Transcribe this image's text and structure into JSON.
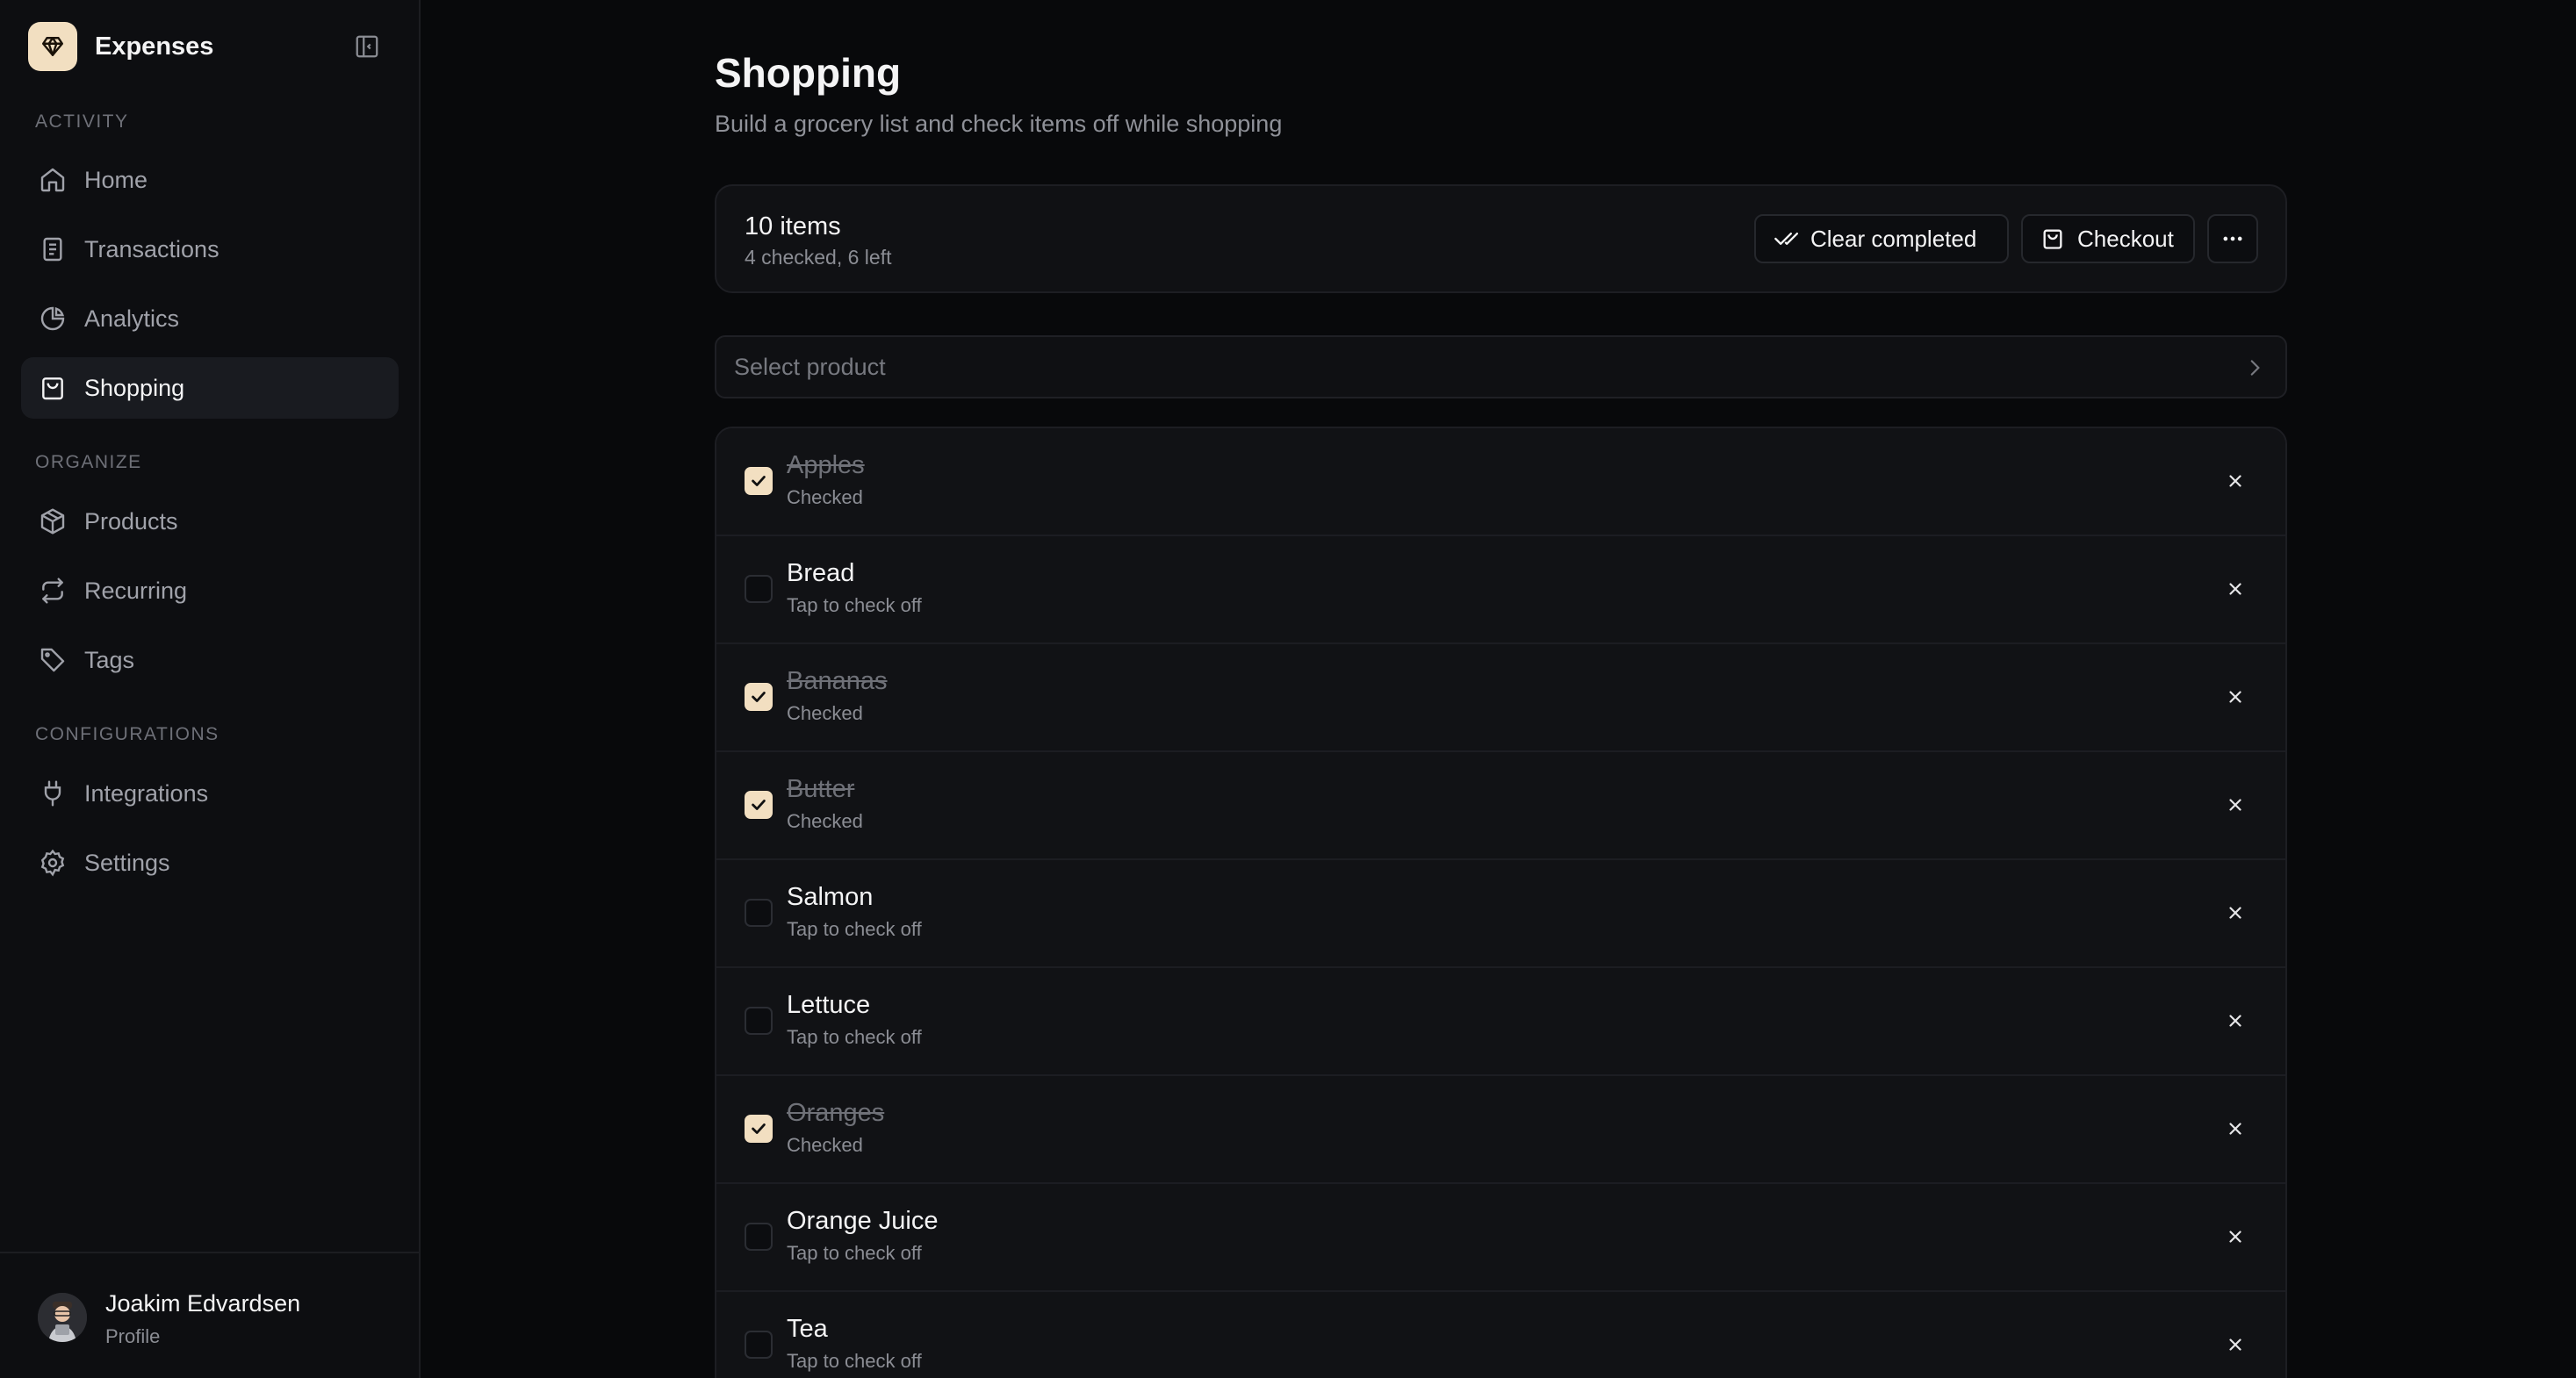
{
  "app": {
    "name": "Expenses"
  },
  "sidebar": {
    "sections": [
      {
        "label": "ACTIVITY"
      },
      {
        "label": "ORGANIZE"
      },
      {
        "label": "CONFIGURATIONS"
      }
    ],
    "items": [
      {
        "label": "Home",
        "icon": "home-icon"
      },
      {
        "label": "Transactions",
        "icon": "receipt-icon"
      },
      {
        "label": "Analytics",
        "icon": "pie-chart-icon"
      },
      {
        "label": "Shopping",
        "icon": "shopping-bag-icon",
        "active": true
      },
      {
        "label": "Products",
        "icon": "package-icon"
      },
      {
        "label": "Recurring",
        "icon": "repeat-icon"
      },
      {
        "label": "Tags",
        "icon": "tag-icon"
      },
      {
        "label": "Integrations",
        "icon": "plug-icon"
      },
      {
        "label": "Settings",
        "icon": "gear-icon"
      }
    ],
    "profile": {
      "name": "Joakim Edvardsen",
      "subtitle": "Profile"
    }
  },
  "page": {
    "title": "Shopping",
    "subtitle": "Build a grocery list and check items off while shopping"
  },
  "summary": {
    "count": "10 items",
    "detail": "4 checked, 6 left",
    "clear_label": "Clear completed",
    "checkout_label": "Checkout"
  },
  "select": {
    "placeholder": "Select product"
  },
  "items": [
    {
      "name": "Apples",
      "status": "Checked",
      "checked": true
    },
    {
      "name": "Bread",
      "status": "Tap to check off",
      "checked": false
    },
    {
      "name": "Bananas",
      "status": "Checked",
      "checked": true
    },
    {
      "name": "Butter",
      "status": "Checked",
      "checked": true
    },
    {
      "name": "Salmon",
      "status": "Tap to check off",
      "checked": false
    },
    {
      "name": "Lettuce",
      "status": "Tap to check off",
      "checked": false
    },
    {
      "name": "Oranges",
      "status": "Checked",
      "checked": true
    },
    {
      "name": "Orange Juice",
      "status": "Tap to check off",
      "checked": false
    },
    {
      "name": "Tea",
      "status": "Tap to check off",
      "checked": false
    }
  ],
  "colors": {
    "accent": "#f2dfc1",
    "background": "#08090b",
    "sidebar": "#0d0e11"
  }
}
